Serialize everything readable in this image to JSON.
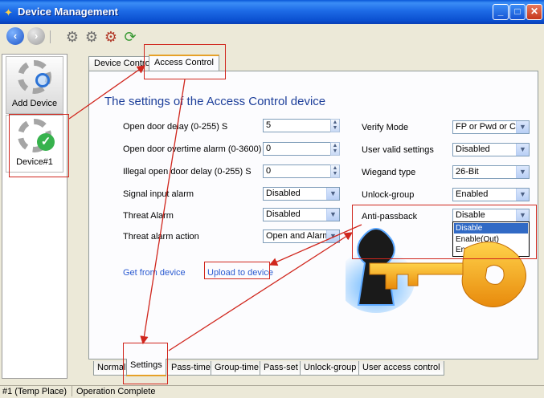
{
  "window": {
    "title": "Device Management"
  },
  "toolbar": {
    "icons": [
      "back-icon",
      "forward-icon",
      "gear-icon",
      "gear-search-icon",
      "gear-delete-icon",
      "refresh-icon"
    ]
  },
  "sidebar": {
    "add_device_label": "Add Device",
    "device_label": "Device#1"
  },
  "tabs": {
    "device_control": "Device Control",
    "access_control": "Access Control"
  },
  "section_title": "The settings of the Access Control device",
  "left_fields": {
    "open_door_delay_label": "Open door delay (0-255) S",
    "open_door_delay_value": "5",
    "overtime_alarm_label": "Open door overtime alarm (0-3600) S",
    "overtime_alarm_value": "0",
    "illegal_delay_label": "Illegal open door delay (0-255) S",
    "illegal_delay_value": "0",
    "signal_input_alarm_label": "Signal input alarm",
    "signal_input_alarm_value": "Disabled",
    "threat_alarm_label": "Threat Alarm",
    "threat_alarm_value": "Disabled",
    "threat_action_label": "Threat alarm action",
    "threat_action_value": "Open and Alarm"
  },
  "right_fields": {
    "verify_mode_label": "Verify Mode",
    "verify_mode_value": "FP or Pwd or Ca",
    "user_valid_label": "User valid settings",
    "user_valid_value": "Disabled",
    "wiegand_label": "Wiegand type",
    "wiegand_value": "26-Bit",
    "unlock_group_label": "Unlock-group",
    "unlock_group_value": "Enabled",
    "anti_passback_label": "Anti-passback",
    "anti_passback_value": "Disable",
    "anti_passback_options": [
      "Disable",
      "Enable(Out)",
      "Enable(In)"
    ]
  },
  "links": {
    "get_from_device": "Get from device",
    "upload_to_device": "Upload to device"
  },
  "bottom_tabs": [
    "Normal",
    "Settings",
    "Pass-time",
    "Group-time",
    "Pass-set",
    "Unlock-group",
    "User access control"
  ],
  "status": {
    "left": "#1 (Temp Place)",
    "right": "Operation Complete"
  },
  "colors": {
    "annotation_red": "#d0261d",
    "title_blue": "#1d3f9a",
    "link_blue": "#2b5bd1",
    "selection_blue": "#316ac5",
    "key_orange": "#f39a12"
  }
}
